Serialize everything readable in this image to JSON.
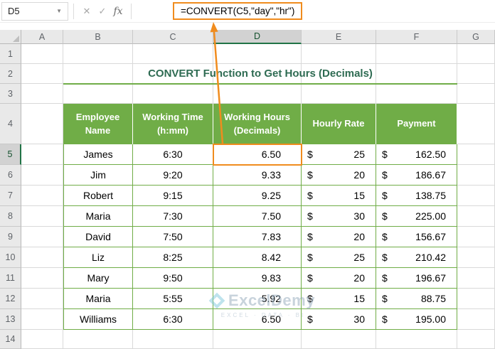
{
  "toolbar": {
    "name_box_value": "D5",
    "cancel_icon": "✕",
    "enter_icon": "✓",
    "fx_icon": "fx",
    "formula": "=CONVERT(C5,\"day\",\"hr\")"
  },
  "sheet": {
    "column_headers": [
      "A",
      "B",
      "C",
      "D",
      "E",
      "F",
      "G"
    ],
    "row_headers": [
      "1",
      "2",
      "3",
      "4",
      "5",
      "6",
      "7",
      "8",
      "9",
      "10",
      "11",
      "12",
      "13",
      "14"
    ],
    "selected_column": "D",
    "selected_row": "5"
  },
  "worksheet": {
    "title": "CONVERT Function to Get Hours (Decimals)"
  },
  "table": {
    "headers": [
      "Employee Name",
      "Working Time (h:mm)",
      "Working Hours (Decimals)",
      "Hourly Rate",
      "Payment"
    ],
    "rows": [
      {
        "name": "James",
        "time": "6:30",
        "hours": "6.50",
        "rate_symbol": "$",
        "rate": "25",
        "payment_symbol": "$",
        "payment": "162.50"
      },
      {
        "name": "Jim",
        "time": "9:20",
        "hours": "9.33",
        "rate_symbol": "$",
        "rate": "20",
        "payment_symbol": "$",
        "payment": "186.67"
      },
      {
        "name": "Robert",
        "time": "9:15",
        "hours": "9.25",
        "rate_symbol": "$",
        "rate": "15",
        "payment_symbol": "$",
        "payment": "138.75"
      },
      {
        "name": "Maria",
        "time": "7:30",
        "hours": "7.50",
        "rate_symbol": "$",
        "rate": "30",
        "payment_symbol": "$",
        "payment": "225.00"
      },
      {
        "name": "David",
        "time": "7:50",
        "hours": "7.83",
        "rate_symbol": "$",
        "rate": "20",
        "payment_symbol": "$",
        "payment": "156.67"
      },
      {
        "name": "Liz",
        "time": "8:25",
        "hours": "8.42",
        "rate_symbol": "$",
        "rate": "25",
        "payment_symbol": "$",
        "payment": "210.42"
      },
      {
        "name": "Mary",
        "time": "9:50",
        "hours": "9.83",
        "rate_symbol": "$",
        "rate": "20",
        "payment_symbol": "$",
        "payment": "196.67"
      },
      {
        "name": "Maria",
        "time": "5:55",
        "hours": "5.92",
        "rate_symbol": "$",
        "rate": "15",
        "payment_symbol": "$",
        "payment": "88.75"
      },
      {
        "name": "Williams",
        "time": "6:30",
        "hours": "6.50",
        "rate_symbol": "$",
        "rate": "30",
        "payment_symbol": "$",
        "payment": "195.00"
      }
    ]
  },
  "watermark": {
    "brand": "ExcelDemy",
    "tagline": "EXCEL · DATA · BI"
  },
  "colors": {
    "table_green": "#70AD47",
    "accent_orange": "#F08C1E",
    "title_green": "#2E6B52",
    "selection_green": "#217346",
    "watermark_gray": "#93A9BB"
  }
}
